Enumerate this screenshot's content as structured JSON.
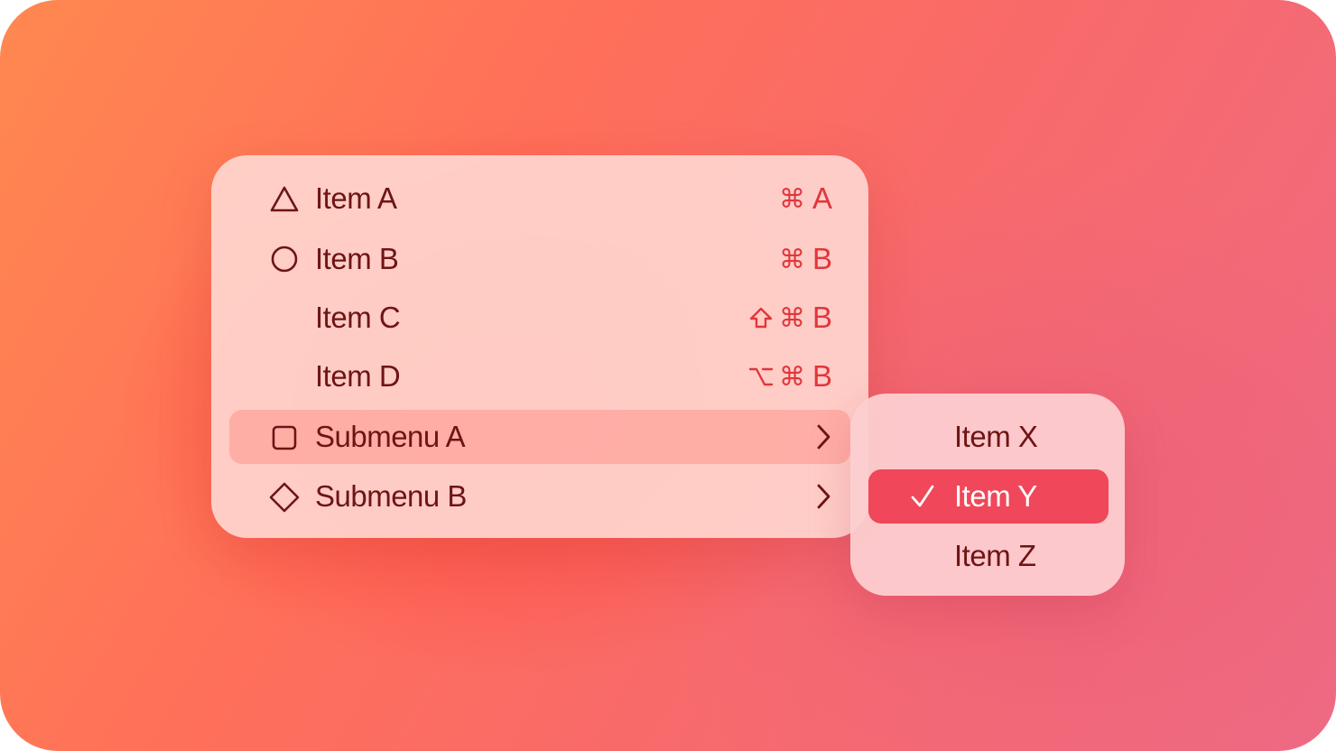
{
  "colors": {
    "label": "#6e1414",
    "shortcut": "#e0363c",
    "highlight_row": "#ff968c",
    "selected_row": "#f0475a",
    "selected_text": "#ffffff"
  },
  "menu": {
    "items": [
      {
        "label": "Item A",
        "icon": "triangle-icon",
        "shortcut": {
          "modifiers": [
            "⌘"
          ],
          "key": "A"
        }
      },
      {
        "label": "Item B",
        "icon": "circle-icon",
        "shortcut": {
          "modifiers": [
            "⌘"
          ],
          "key": "B"
        }
      },
      {
        "label": "Item C",
        "icon": null,
        "shortcut": {
          "modifiers": [
            "⇧",
            "⌘"
          ],
          "key": "B"
        }
      },
      {
        "label": "Item D",
        "icon": null,
        "shortcut": {
          "modifiers": [
            "⌥",
            "⌘"
          ],
          "key": "B"
        }
      },
      {
        "label": "Submenu A",
        "icon": "square-icon",
        "has_submenu": true,
        "highlighted": true
      },
      {
        "label": "Submenu B",
        "icon": "diamond-icon",
        "has_submenu": true
      }
    ]
  },
  "submenu": {
    "items": [
      {
        "label": "Item X",
        "checked": false
      },
      {
        "label": "Item Y",
        "checked": true,
        "selected": true
      },
      {
        "label": "Item Z",
        "checked": false
      }
    ]
  }
}
